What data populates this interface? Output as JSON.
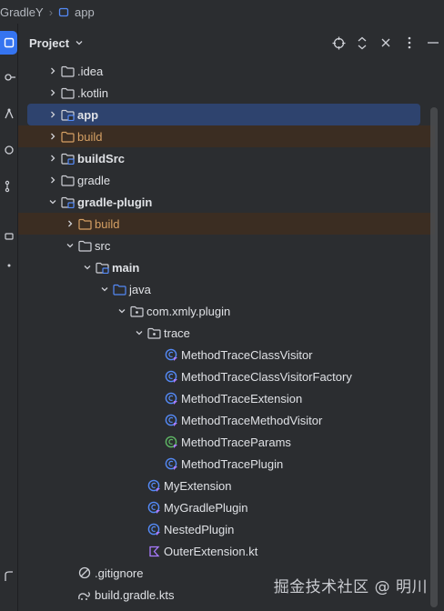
{
  "breadcrumb": {
    "project": "GradleY",
    "module": "app"
  },
  "panel": {
    "title": "Project"
  },
  "tree": [
    {
      "label": ".idea",
      "depth": 0,
      "arrow": "right",
      "icon": "folder"
    },
    {
      "label": ".kotlin",
      "depth": 0,
      "arrow": "right",
      "icon": "folder"
    },
    {
      "label": "app",
      "depth": 0,
      "arrow": "right",
      "icon": "module-folder",
      "bold": true,
      "selected": true
    },
    {
      "label": "build",
      "depth": 0,
      "arrow": "right",
      "icon": "excluded-folder",
      "orange": true,
      "excluded": true
    },
    {
      "label": "buildSrc",
      "depth": 0,
      "arrow": "right",
      "icon": "module-folder",
      "bold": true
    },
    {
      "label": "gradle",
      "depth": 0,
      "arrow": "right",
      "icon": "folder"
    },
    {
      "label": "gradle-plugin",
      "depth": 0,
      "arrow": "down",
      "icon": "module-folder",
      "bold": true
    },
    {
      "label": "build",
      "depth": 1,
      "arrow": "right",
      "icon": "excluded-folder",
      "orange": true,
      "excluded": true
    },
    {
      "label": "src",
      "depth": 1,
      "arrow": "down",
      "icon": "folder"
    },
    {
      "label": "main",
      "depth": 2,
      "arrow": "down",
      "icon": "module-folder",
      "bold": true
    },
    {
      "label": "java",
      "depth": 3,
      "arrow": "down",
      "icon": "source-folder"
    },
    {
      "label": "com.xmly.plugin",
      "depth": 4,
      "arrow": "down",
      "icon": "package"
    },
    {
      "label": "trace",
      "depth": 5,
      "arrow": "down",
      "icon": "package"
    },
    {
      "label": "MethodTraceClassVisitor",
      "depth": 6,
      "arrow": "none",
      "icon": "kotlin-class"
    },
    {
      "label": "MethodTraceClassVisitorFactory",
      "depth": 6,
      "arrow": "none",
      "icon": "kotlin-class"
    },
    {
      "label": "MethodTraceExtension",
      "depth": 6,
      "arrow": "none",
      "icon": "kotlin-class"
    },
    {
      "label": "MethodTraceMethodVisitor",
      "depth": 6,
      "arrow": "none",
      "icon": "kotlin-class"
    },
    {
      "label": "MethodTraceParams",
      "depth": 6,
      "arrow": "none",
      "icon": "kotlin-data-class"
    },
    {
      "label": "MethodTracePlugin",
      "depth": 6,
      "arrow": "none",
      "icon": "kotlin-class"
    },
    {
      "label": "MyExtension",
      "depth": 5,
      "arrow": "none",
      "icon": "kotlin-class"
    },
    {
      "label": "MyGradlePlugin",
      "depth": 5,
      "arrow": "none",
      "icon": "kotlin-class"
    },
    {
      "label": "NestedPlugin",
      "depth": 5,
      "arrow": "none",
      "icon": "kotlin-class"
    },
    {
      "label": "OuterExtension.kt",
      "depth": 5,
      "arrow": "none",
      "icon": "kotlin-file"
    },
    {
      "label": ".gitignore",
      "depth": 1,
      "arrow": "none",
      "icon": "ignore-file"
    },
    {
      "label": "build.gradle.kts",
      "depth": 1,
      "arrow": "none",
      "icon": "gradle-file"
    }
  ],
  "watermark": "掘金技术社区 @ 明川",
  "colors": {
    "background": "#2b2d30",
    "selection": "#2e436e",
    "excluded_row": "#3b2d22",
    "excluded_text": "#d5a064",
    "accent": "#3574f0",
    "kotlin_class": "#548af7",
    "kotlin_data_class": "#5fb865"
  }
}
